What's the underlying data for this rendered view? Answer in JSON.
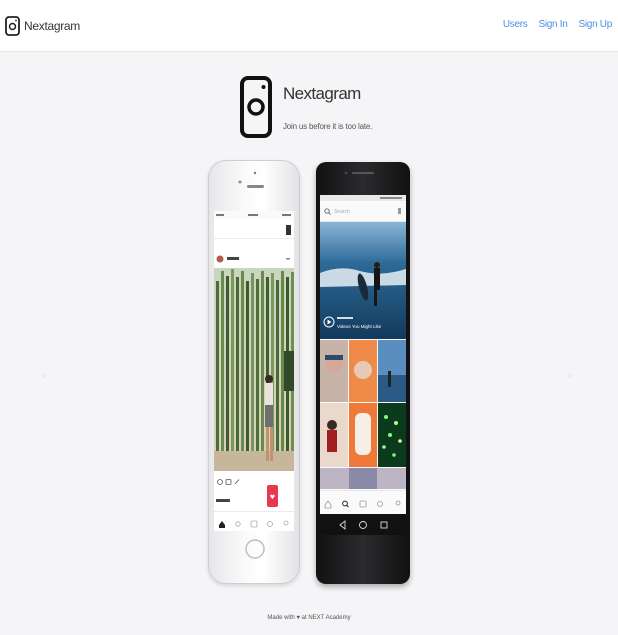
{
  "navbar": {
    "brand": "Nextagram",
    "links": [
      "Users",
      "Sign In",
      "Sign Up"
    ]
  },
  "hero": {
    "title": "Nextagram",
    "subtitle": "Join us before it is too late."
  },
  "phone_left": {
    "status_left": "",
    "status_right": "",
    "post_user": "",
    "likes": ""
  },
  "phone_right": {
    "search_placeholder": "Search",
    "video_caption": "Videos You Might Like"
  },
  "footer": {
    "text": "Made with ♥ at NEXT Academy"
  },
  "colors": {
    "accent": "#4a90e2",
    "background": "#f5f5f7",
    "heart_badge": "#e8384f"
  }
}
